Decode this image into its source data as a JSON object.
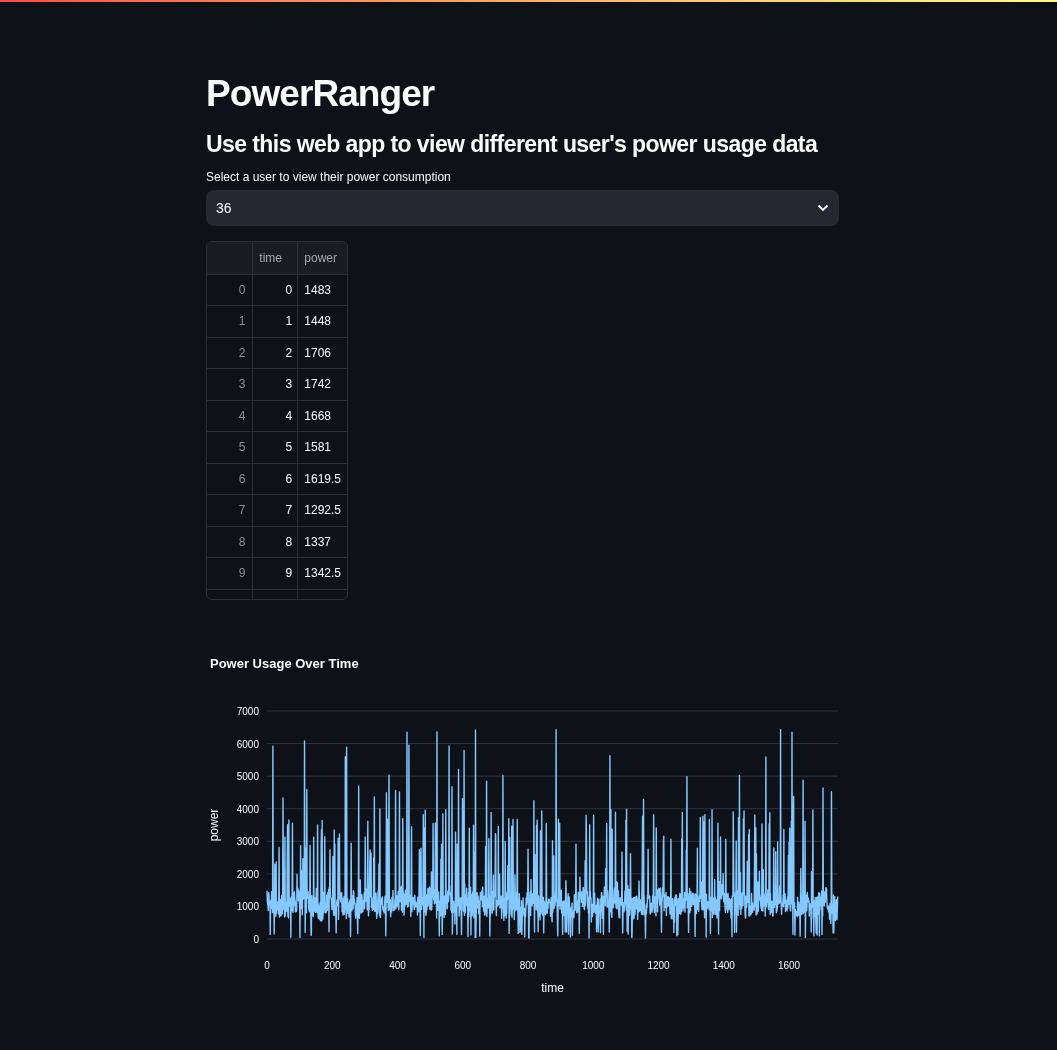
{
  "title": "PowerRanger",
  "subtitle": "Use this web app to view different user's power usage data",
  "user_select": {
    "label": "Select a user to view their power consumption",
    "value": "36"
  },
  "table": {
    "columns": [
      "time",
      "power"
    ],
    "rows": [
      {
        "index": "0",
        "time": "0",
        "power": "1483"
      },
      {
        "index": "1",
        "time": "1",
        "power": "1448"
      },
      {
        "index": "2",
        "time": "2",
        "power": "1706"
      },
      {
        "index": "3",
        "time": "3",
        "power": "1742"
      },
      {
        "index": "4",
        "time": "4",
        "power": "1668"
      },
      {
        "index": "5",
        "time": "5",
        "power": "1581"
      },
      {
        "index": "6",
        "time": "6",
        "power": "1619.5"
      },
      {
        "index": "7",
        "time": "7",
        "power": "1292.5"
      },
      {
        "index": "8",
        "time": "8",
        "power": "1337"
      },
      {
        "index": "9",
        "time": "9",
        "power": "1342.5"
      }
    ]
  },
  "chart": {
    "title": "Power Usage Over Time",
    "xlabel": "time",
    "ylabel": "power",
    "xticks": [
      "0",
      "200",
      "400",
      "600",
      "800",
      "1000",
      "1200",
      "1400",
      "1600"
    ],
    "yticks": [
      "7000",
      "6000",
      "5000",
      "4000",
      "3000",
      "2000",
      "1000",
      "0"
    ]
  }
}
